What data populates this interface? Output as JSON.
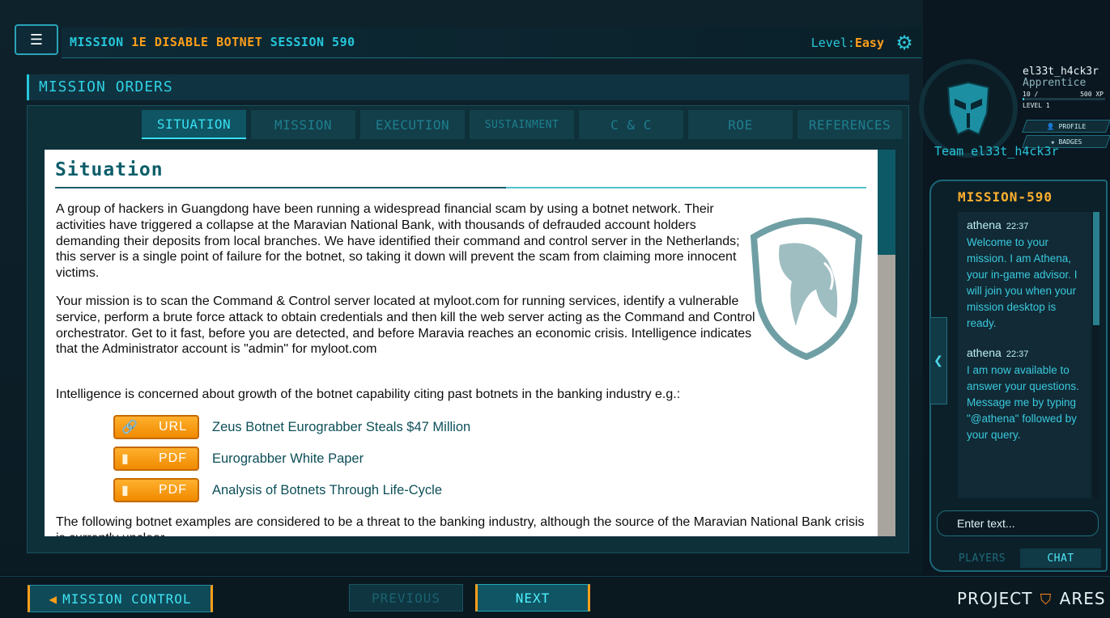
{
  "header": {
    "mission_prefix": "MISSION ",
    "mission_id": "1E DISABLE BOTNET",
    "session": " SESSION 590",
    "level_label": "Level:",
    "level_value": "Easy"
  },
  "orders": {
    "title": "MISSION ORDERS",
    "tabs": [
      {
        "label": "SITUATION",
        "active": true
      },
      {
        "label": "MISSION"
      },
      {
        "label": "EXECUTION"
      },
      {
        "label": "SUSTAINMENT"
      },
      {
        "label": "C & C"
      },
      {
        "label": "ROE"
      },
      {
        "label": "REFERENCES"
      }
    ]
  },
  "document": {
    "title": "Situation",
    "p1": "A group of hackers in Guangdong have been running a widespread financial scam by using a botnet network. Their activities have triggered a collapse at the Maravian National Bank, with thousands of defrauded account holders demanding their deposits from local branches. We have identified their command and control server in the Netherlands; this server is a single point of failure for the botnet, so taking it down will prevent the scam from claiming more innocent victims.",
    "p2": "Your mission is to scan the Command & Control server located at myloot.com for running services, identify a vulnerable service, perform a brute force attack to obtain credentials and then kill the web server acting as the Command and Control orchestrator. Get to it fast, before you are detected, and before Maravia reaches an economic crisis. Intelligence indicates that the Administrator account is \"admin\" for myloot.com",
    "p3": "Intelligence is concerned about growth of the botnet capability citing past botnets in the banking industry e.g.:",
    "resources": [
      {
        "type": "URL",
        "icon": "link-icon",
        "title": "Zeus Botnet Eurograbber Steals $47 Million"
      },
      {
        "type": "PDF",
        "icon": "file-icon",
        "title": "Eurograbber White Paper"
      },
      {
        "type": "PDF",
        "icon": "file-icon",
        "title": "Analysis of Botnets Through Life-Cycle"
      }
    ],
    "p4": "The following botnet examples are considered to be a threat to the banking industry, although the source of the Maravian National Bank crisis is currently unclear."
  },
  "footer": {
    "mission_control": "MISSION CONTROL",
    "previous": "PREVIOUS",
    "next": "NEXT",
    "brand_a": "PROJECT",
    "brand_b": "ARES"
  },
  "profile": {
    "username": "el33t_h4ck3r",
    "rank": "Apprentice",
    "xp_current": "10 /",
    "xp_total": "500 XP",
    "xp_progress": 0.02,
    "level": "LEVEL 1",
    "profile_btn": "PROFILE",
    "badges_btn": "BADGES",
    "team": "Team el33t_h4ck3r"
  },
  "chat": {
    "title": "MISSION-590",
    "messages": [
      {
        "author": "athena",
        "time": "22:37",
        "text": "Welcome to your mission. I am Athena, your in-game advisor. I will join you when your mission desktop is ready."
      },
      {
        "author": "athena",
        "time": "22:37",
        "text": "I am now available to answer your questions. Message me by typing \"@athena\" followed by your query."
      }
    ],
    "input_placeholder": "Enter text...",
    "tab_players": "PLAYERS",
    "tab_chat": "CHAT"
  },
  "colors": {
    "accent": "#26c6da",
    "highlight": "#ff9f1a",
    "doc_heading": "#0d5e6a"
  }
}
